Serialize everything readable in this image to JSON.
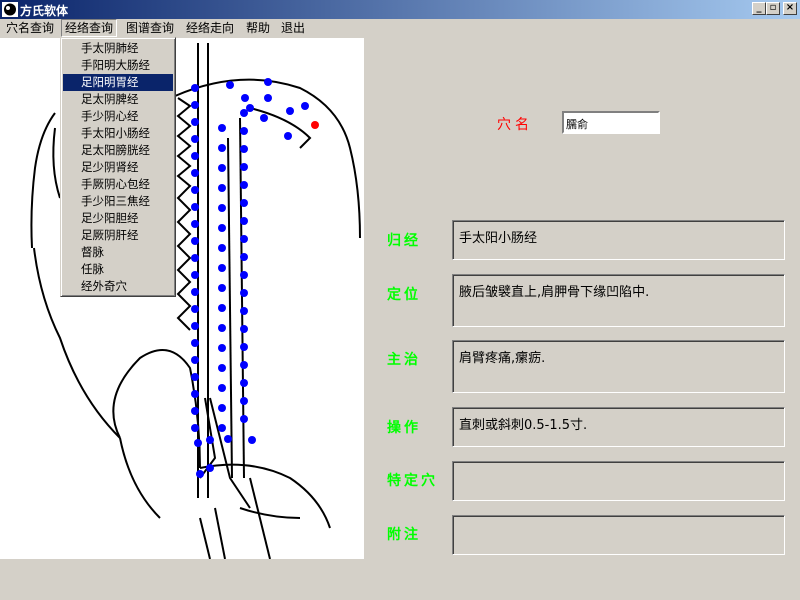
{
  "window": {
    "title": "方氏软体"
  },
  "menu": {
    "items": [
      "穴名查询",
      "经络查询",
      "图谱查询",
      "经络走向",
      "帮助",
      "退出"
    ],
    "open_index": 1
  },
  "dropdown": {
    "items": [
      "手太阴肺经",
      "手阳明大肠经",
      "足阳明胃经",
      "足太阴脾经",
      "手少阴心经",
      "手太阳小肠经",
      "足太阳膀胱经",
      "足少阴肾经",
      "手厥阴心包经",
      "手少阳三焦经",
      "足少阳胆经",
      "足厥阴肝经",
      "督脉",
      "任脉",
      "经外奇穴"
    ],
    "selected_index": 2
  },
  "acupoint": {
    "name_label": "穴名",
    "name_value": "臑俞"
  },
  "fields": [
    {
      "label": "归经",
      "value": "手太阳小肠经"
    },
    {
      "label": "定位",
      "value": "腋后皱襞直上,肩胛骨下缘凹陷中."
    },
    {
      "label": "主治",
      "value": "肩臂疼痛,瘰疬."
    },
    {
      "label": "操作",
      "value": "直刺或斜刺0.5-1.5寸."
    },
    {
      "label": "特定穴",
      "value": ""
    },
    {
      "label": "附注",
      "value": ""
    }
  ],
  "colors": {
    "point": "#0000ff",
    "highlight_point": "#ff0000",
    "label_red": "#ff0000",
    "label_green": "#00ff00"
  }
}
